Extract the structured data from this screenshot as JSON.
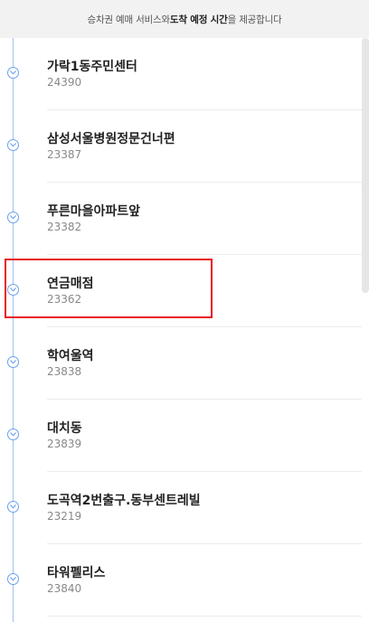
{
  "banner": {
    "prefix": "승차권 예매 서비스와 ",
    "bold": "도착 예정 시간",
    "suffix": "을 제공합니다"
  },
  "stops": [
    {
      "name": "가락1동주민센터",
      "code": "24390"
    },
    {
      "name": "삼성서울병원정문건너편",
      "code": "23387"
    },
    {
      "name": "푸른마을아파트앞",
      "code": "23382"
    },
    {
      "name": "연금매점",
      "code": "23362"
    },
    {
      "name": "학여울역",
      "code": "23838"
    },
    {
      "name": "대치동",
      "code": "23839"
    },
    {
      "name": "도곡역2번출구.동부센트레빌",
      "code": "23219"
    },
    {
      "name": "타워펠리스",
      "code": "23840"
    }
  ],
  "colors": {
    "route_line": "#9ec2f5",
    "marker_border": "#6aa0ee",
    "highlight": "#e8141b"
  },
  "icons": {
    "stop_marker": "chevron-down-circle-icon"
  }
}
